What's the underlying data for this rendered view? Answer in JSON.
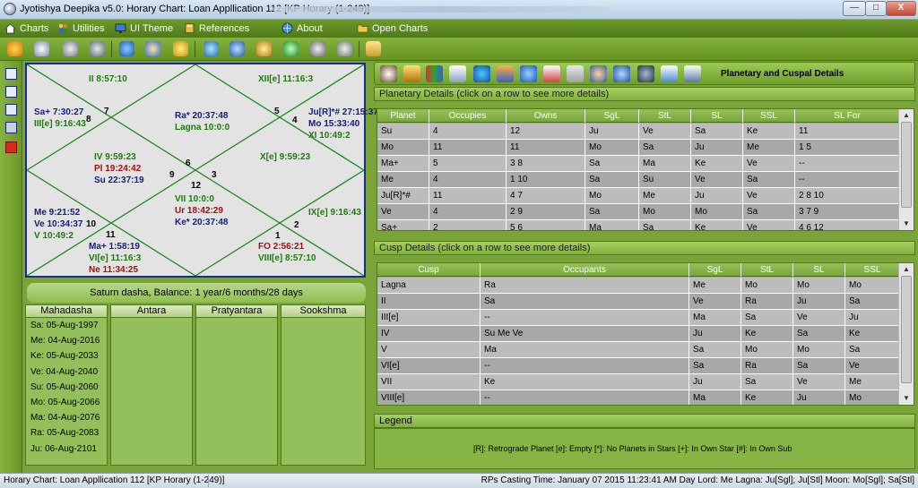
{
  "window": {
    "title": "Jyotishya Deepika v5.0:  Horary Chart: Loan Appllication 112 [KP Horary (1-249)]",
    "min": "—",
    "max": "□",
    "close": "X"
  },
  "menu": [
    {
      "label": "Charts",
      "icon": "home-icon"
    },
    {
      "label": "Utilities",
      "icon": "people-icon"
    },
    {
      "label": "UI Theme",
      "icon": "monitor-icon"
    },
    {
      "label": "References",
      "icon": "book-icon"
    },
    {
      "label": "About",
      "icon": "globe-icon"
    },
    {
      "label": "Open Charts",
      "icon": "folder-icon"
    }
  ],
  "toolbar_icons": [
    "chart-icon",
    "clock-icon",
    "gauge-icon",
    "settings-icon",
    "monitor-icon",
    "globe-icon",
    "people-icon",
    "coins-icon",
    "star-icon",
    "rings-icon",
    "globe-icon",
    "pen-icon",
    "refresh-icon",
    "person-icon",
    "scale-icon",
    "help-icon"
  ],
  "left_icons": [
    "save-icon",
    "open-icon",
    "edit-icon",
    "print-icon",
    "close-icon"
  ],
  "chart": {
    "houses": {
      "h1": "1",
      "h2": "2",
      "h3": "3",
      "h4": "4",
      "h5": "5",
      "h6": "6",
      "h7": "7",
      "h8": "8",
      "h9": "9",
      "h10": "10",
      "h11": "11",
      "h12": "12"
    },
    "texts": {
      "ii": "II 8:57:10",
      "xii": "XII[e] 11:16:3",
      "sa": "Sa+ 7:30:27",
      "iii": "III[e] 9:16:43",
      "ra": "Ra* 20:37:48",
      "lagna": "Lagna 10:0:0",
      "ju": "Ju[R]*# 27:15:37",
      "mo": "Mo 15:33:40",
      "xi": "XI 10:49:2",
      "iv": "IV 9:59:23",
      "pl": "Pl 19:24:42",
      "su": "Su 22:37:19",
      "x": "X[e] 9:59:23",
      "vii": "VII 10:0:0",
      "ur": "Ur 18:42:29",
      "ke": "Ke* 20:37:48",
      "me": "Me 9:21:52",
      "ve": "Ve 10:34:37",
      "v": "V 10:49:2",
      "ix": "IX[e] 9:16:43",
      "ma": "Ma+ 1:58:19",
      "vi": "VI[e] 11:16:3",
      "ne": "Ne 11:34:25",
      "fo": "FO 2:56:21",
      "viii": "VIII[e] 8:57:10"
    }
  },
  "dasha": {
    "banner": "Saturn dasha, Balance: 1 year/6 months/28 days",
    "headers": [
      "Mahadasha",
      "Antara",
      "Pratyantara",
      "Sookshma"
    ],
    "mahadasha": [
      "Sa: 05-Aug-1997",
      "Me: 04-Aug-2016",
      "Ke: 05-Aug-2033",
      "Ve: 04-Aug-2040",
      "Su: 05-Aug-2060",
      "Mo: 05-Aug-2066",
      "Ma: 04-Aug-2076",
      "Ra: 05-Aug-2083",
      "Ju: 06-Aug-2101"
    ]
  },
  "right_header": {
    "title": "Planetary and Cuspal Details",
    "icons": [
      "globe-icon",
      "house-icon",
      "bar-chart-icon",
      "flag-icon",
      "star-icon",
      "tools-icon",
      "refresh-icon",
      "calendar-icon",
      "line-chart-icon",
      "person-icon",
      "globe-icon",
      "dial-icon",
      "image-icon",
      "table-icon"
    ]
  },
  "planetary": {
    "title": "Planetary Details (click on a row to see more details)",
    "headers": [
      "Planet",
      "Occupies",
      "Owns",
      "SgL",
      "StL",
      "SL",
      "SSL",
      "SL For"
    ],
    "rows": [
      [
        "Su",
        "4",
        "12",
        "Ju",
        "Ve",
        "Sa",
        "Ke",
        "11"
      ],
      [
        "Mo",
        "11",
        "11",
        "Mo",
        "Sa",
        "Ju",
        "Me",
        "1  5"
      ],
      [
        "Ma+",
        "5",
        "3  8",
        "Sa",
        "Ma",
        "Ke",
        "Ve",
        "--"
      ],
      [
        "Me",
        "4",
        "1  10",
        "Sa",
        "Su",
        "Ve",
        "Sa",
        "--"
      ],
      [
        "Ju[R]*#",
        "11",
        "4  7",
        "Mo",
        "Me",
        "Ju",
        "Ve",
        "2  8  10"
      ],
      [
        "Ve",
        "4",
        "2  9",
        "Sa",
        "Mo",
        "Mo",
        "Sa",
        "3  7  9"
      ],
      [
        "Sa+",
        "2",
        "5  6",
        "Ma",
        "Sa",
        "Ke",
        "Ve",
        "4  6  12"
      ]
    ]
  },
  "cusp": {
    "title": "Cusp Details (click on a row to see more details)",
    "headers": [
      "Cusp",
      "Occupants",
      "SgL",
      "StL",
      "SL",
      "SSL"
    ],
    "rows": [
      [
        "Lagna",
        "Ra",
        "Me",
        "Mo",
        "Mo",
        "Mo"
      ],
      [
        "II",
        "Sa",
        "Ve",
        "Ra",
        "Ju",
        "Sa"
      ],
      [
        "III[e]",
        "--",
        "Ma",
        "Sa",
        "Ve",
        "Ju"
      ],
      [
        "IV",
        "Su Me Ve",
        "Ju",
        "Ke",
        "Sa",
        "Ke"
      ],
      [
        "V",
        "Ma",
        "Sa",
        "Mo",
        "Mo",
        "Sa"
      ],
      [
        "VI[e]",
        "--",
        "Sa",
        "Ra",
        "Sa",
        "Ve"
      ],
      [
        "VII",
        "Ke",
        "Ju",
        "Sa",
        "Ve",
        "Me"
      ],
      [
        "VIII[e]",
        "--",
        "Ma",
        "Ke",
        "Ju",
        "Mo"
      ]
    ]
  },
  "legend": {
    "title": "Legend",
    "text": "[R]:  Retrograde Planet   [e]:  Empty   [*]:  No Planets in Stars   [+]:  In Own Star   [#]:  In Own Sub"
  },
  "status": {
    "left": "Horary Chart: Loan Appllication 112 [KP Horary (1-249)]",
    "right": "RPs Casting Time: January 07 2015 11:23:41 AM  Day Lord: Me  Lagna: Ju[Sgl]; Ju[Stl]   Moon: Mo[Sgl]; Sa[Stl]"
  }
}
